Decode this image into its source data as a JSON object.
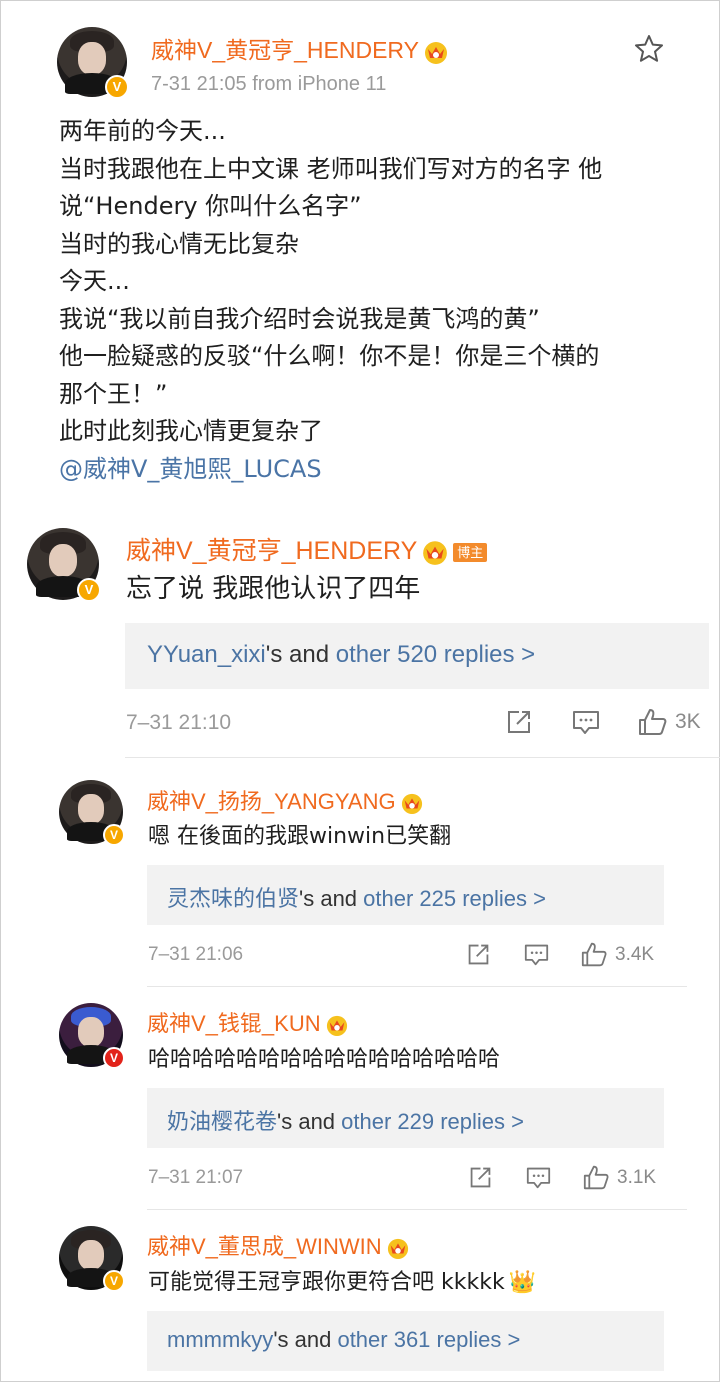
{
  "post": {
    "username": "威神V_黄冠亨_HENDERY",
    "meta": "7-31 21:05  from iPhone 11",
    "lines": [
      "两年前的今天...",
      "当时我跟他在上中文课 老师叫我们写对方的名字 他",
      "说“Hendery 你叫什么名字”",
      "当时的我心情无比复杂",
      "今天...",
      "我说“我以前自我介绍时会说我是黄飞鸿的黄”",
      "他一脸疑惑的反驳“什么啊！你不是！你是三个横的",
      "那个王！”",
      "此时此刻我心情更复杂了"
    ],
    "mention": "@威神V_黄旭熙_LUCAS",
    "star_icon": "star-icon"
  },
  "comments": [
    {
      "username": "威神V_黄冠亨_HENDERY",
      "tag": "博主",
      "text": "忘了说 我跟他认识了四年",
      "reply_user": "YYuan_xixi",
      "reply_mid": "'s and ",
      "reply_more": "other 520 replies >",
      "time": "7–31 21:10",
      "likes": "3K"
    },
    {
      "username": "威神V_扬扬_YANGYANG",
      "text": "嗯 在後面的我跟winwin已笑翻",
      "reply_user": "灵杰味的伯贤",
      "reply_mid": "'s and ",
      "reply_more": "other 225 replies >",
      "time": "7–31 21:06",
      "likes": "3.4K"
    },
    {
      "username": "威神V_钱锟_KUN",
      "text": "哈哈哈哈哈哈哈哈哈哈哈哈哈哈哈哈",
      "reply_user": "奶油樱花卷",
      "reply_mid": "'s and ",
      "reply_more": "other 229 replies >",
      "time": "7–31 21:07",
      "likes": "3.1K"
    },
    {
      "username": "威神V_董思成_WINWIN",
      "text": "可能觉得王冠亨跟你更符合吧 kkkkk",
      "emoji": "👑",
      "reply_user": "mmmmkyy",
      "reply_mid": "'s and ",
      "reply_more": "other 361 replies >"
    }
  ],
  "colors": {
    "username": "#f06a1f",
    "link": "#4b74a4",
    "meta": "#9a9a9a",
    "reply_bg": "#f2f2f2",
    "verified": "#f7a700"
  }
}
